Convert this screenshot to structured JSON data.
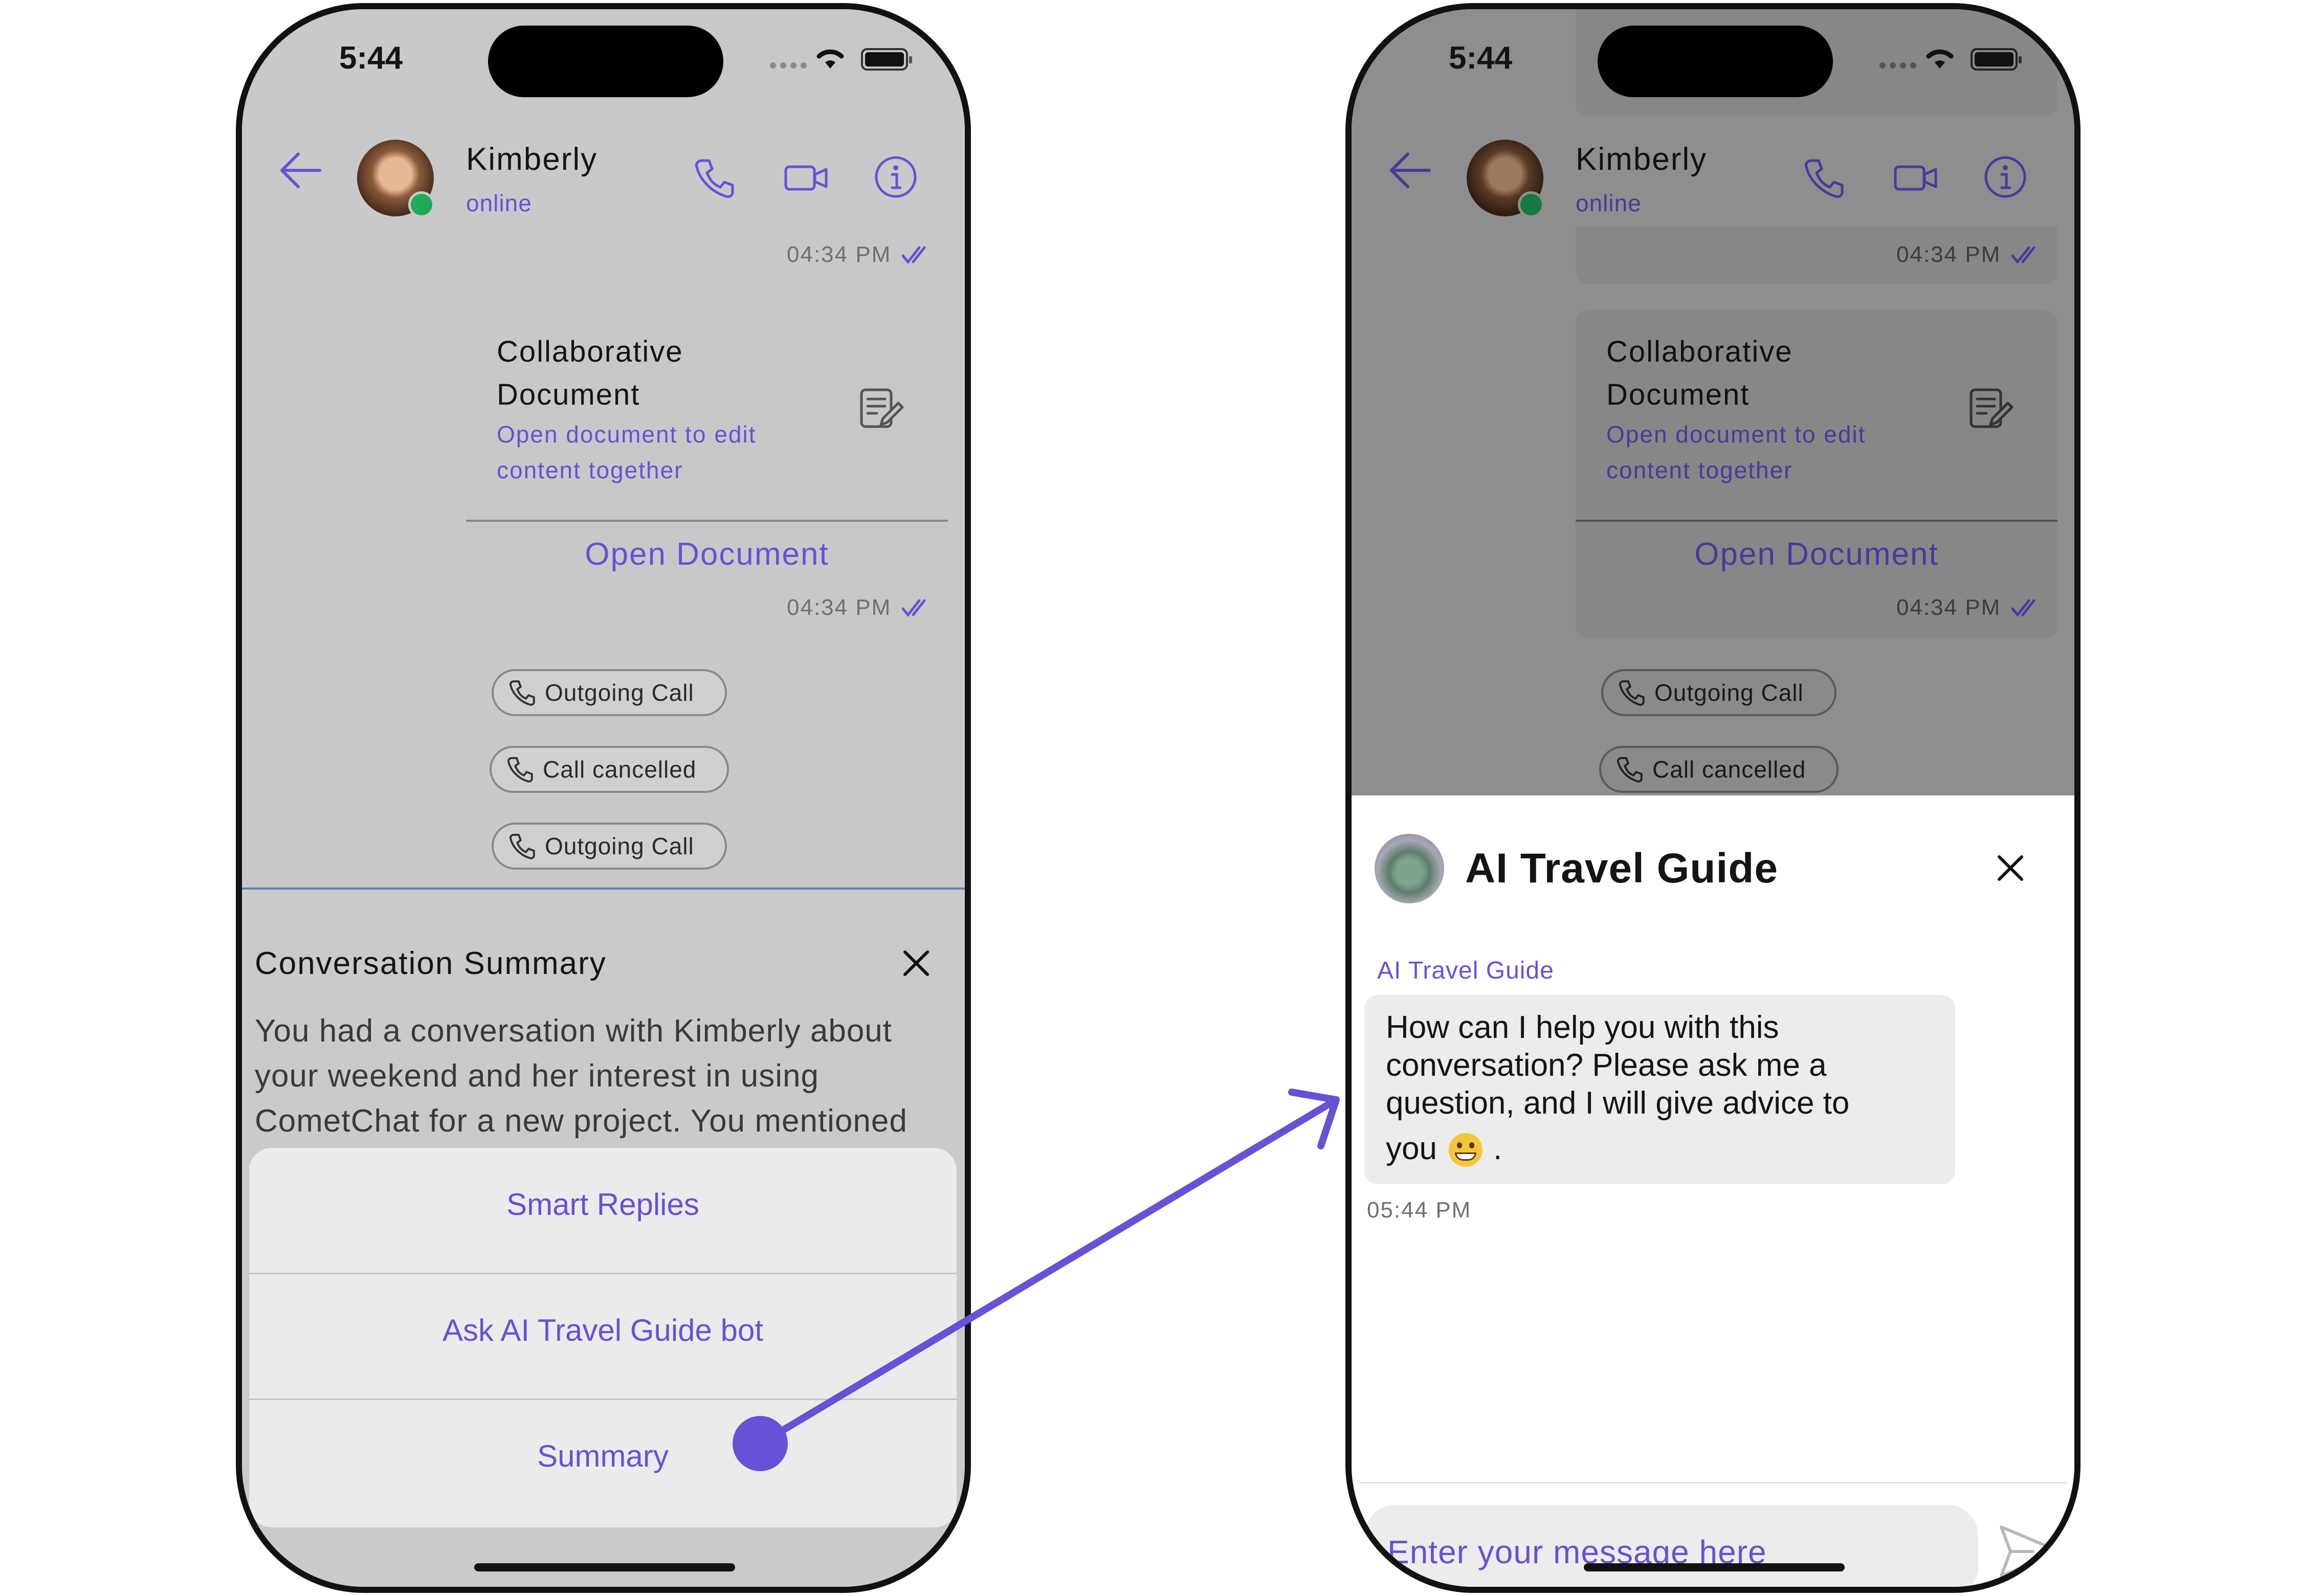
{
  "left": {
    "status": {
      "time": "5:44"
    },
    "header": {
      "name": "Kimberly",
      "status": "online"
    },
    "bubble1": {
      "time": "04:34 PM"
    },
    "document": {
      "title_line1": "Collaborative",
      "title_line2": "Document",
      "subtitle_line1": "Open document to edit",
      "subtitle_line2": "content together",
      "button": "Open Document",
      "time": "04:34 PM"
    },
    "calls": [
      "Outgoing Call",
      "Call cancelled",
      "Outgoing Call"
    ],
    "summary": {
      "title": "Conversation Summary",
      "line1": "You had a conversation with Kimberly about",
      "line2": "your weekend and her interest in using",
      "line3": "CometChat for a new project. You mentioned"
    },
    "menu": {
      "items": [
        "Smart Replies",
        "Ask AI Travel Guide bot",
        "Summary"
      ]
    }
  },
  "right": {
    "status": {
      "time": "5:44"
    },
    "header": {
      "name": "Kimberly",
      "status": "online"
    },
    "bubble1": {
      "time": "04:34 PM"
    },
    "document": {
      "title_line1": "Collaborative",
      "title_line2": "Document",
      "subtitle_line1": "Open document to edit",
      "subtitle_line2": "content together",
      "button": "Open Document",
      "time": "04:34 PM"
    },
    "calls": [
      "Outgoing Call",
      "Call cancelled"
    ],
    "sheet": {
      "title": "AI Travel Guide",
      "sender": "AI Travel Guide",
      "message_line1": "How can I help you with this",
      "message_line2": "conversation? Please ask me a",
      "message_line3": "question, and I will give advice to",
      "message_line4": "you",
      "message_tail": ".",
      "time": "05:44 PM",
      "input_placeholder": "Enter your message here"
    }
  },
  "colors": {
    "accent": "#6851D6",
    "online": "#1FAA59"
  },
  "icons": [
    "back-arrow-icon",
    "phone-icon",
    "video-icon",
    "info-icon",
    "double-check-icon",
    "document-edit-icon",
    "call-icon",
    "close-icon",
    "send-icon",
    "grin-emoji-icon",
    "statue-of-liberty-avatar"
  ]
}
